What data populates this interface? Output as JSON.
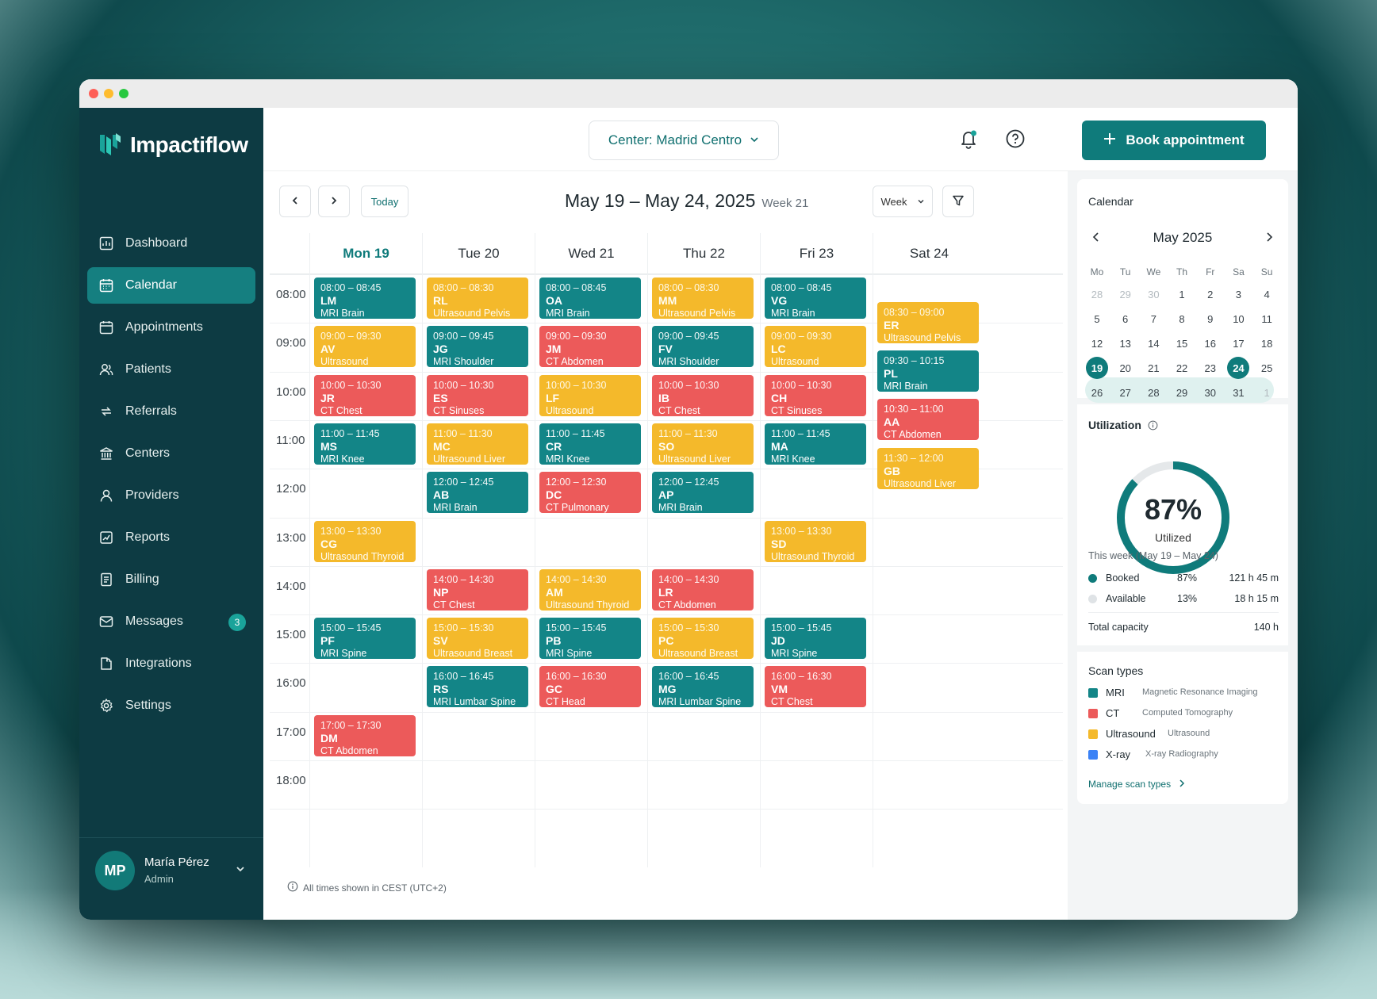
{
  "app": {
    "brand": "Impactiflow"
  },
  "sidebar": {
    "items": [
      {
        "label": "Dashboard",
        "icon": "dashboard-icon"
      },
      {
        "label": "Calendar",
        "icon": "calendar-icon",
        "active": true
      },
      {
        "label": "Appointments",
        "icon": "appointments-icon"
      },
      {
        "label": "Patients",
        "icon": "patients-icon"
      },
      {
        "label": "Referrals",
        "icon": "referrals-icon"
      },
      {
        "label": "Centers",
        "icon": "centers-icon"
      },
      {
        "label": "Providers",
        "icon": "providers-icon"
      },
      {
        "label": "Reports",
        "icon": "reports-icon"
      },
      {
        "label": "Billing",
        "icon": "billing-icon"
      },
      {
        "label": "Messages",
        "icon": "messages-icon",
        "badge": "3"
      },
      {
        "label": "Integrations",
        "icon": "integrations-icon"
      },
      {
        "label": "Settings",
        "icon": "settings-icon"
      }
    ],
    "user": {
      "initials": "MP",
      "name": "María Pérez",
      "role": "Admin"
    }
  },
  "topbar": {
    "center_select": "Center: Madrid Centro",
    "book_label": "Book appointment"
  },
  "toolbar": {
    "today_label": "Today",
    "range": "May 19 – May 24, 2025",
    "week": "Week 21",
    "view": "Week"
  },
  "days": [
    "Mon 19",
    "Tue 20",
    "Wed 21",
    "Thu 22",
    "Fri 23",
    "Sat 24"
  ],
  "hours": [
    "08:00",
    "09:00",
    "10:00",
    "11:00",
    "12:00",
    "13:00",
    "14:00",
    "15:00",
    "16:00",
    "17:00",
    "18:00"
  ],
  "events": [
    {
      "day": 0,
      "time": "08:00 – 08:45",
      "initials": "LM",
      "type": "MRI Brain",
      "kind": "mri"
    },
    {
      "day": 0,
      "time": "09:00 – 09:30",
      "initials": "AV",
      "type": "Ultrasound Abdomen",
      "kind": "us"
    },
    {
      "day": 0,
      "time": "10:00 – 10:30",
      "initials": "JR",
      "type": "CT Chest",
      "kind": "ct"
    },
    {
      "day": 0,
      "time": "11:00 – 11:45",
      "initials": "MS",
      "type": "MRI Knee",
      "kind": "mri"
    },
    {
      "day": 0,
      "time": "13:00 – 13:30",
      "initials": "CG",
      "type": "Ultrasound Thyroid",
      "kind": "us"
    },
    {
      "day": 0,
      "time": "15:00 – 15:45",
      "initials": "PF",
      "type": "MRI Spine",
      "kind": "mri"
    },
    {
      "day": 0,
      "time": "17:00 – 17:30",
      "initials": "DM",
      "type": "CT Abdomen",
      "kind": "ct"
    },
    {
      "day": 1,
      "time": "08:00 – 08:30",
      "initials": "RL",
      "type": "Ultrasound Pelvis",
      "kind": "us"
    },
    {
      "day": 1,
      "time": "09:00 – 09:45",
      "initials": "JG",
      "type": "MRI Shoulder",
      "kind": "mri"
    },
    {
      "day": 1,
      "time": "10:00 – 10:30",
      "initials": "ES",
      "type": "CT Sinuses",
      "kind": "ct"
    },
    {
      "day": 1,
      "time": "11:00 – 11:30",
      "initials": "MC",
      "type": "Ultrasound Liver",
      "kind": "us"
    },
    {
      "day": 1,
      "time": "12:00 – 12:45",
      "initials": "AB",
      "type": "MRI Brain",
      "kind": "mri"
    },
    {
      "day": 1,
      "time": "14:00 – 14:30",
      "initials": "NP",
      "type": "CT Chest",
      "kind": "ct"
    },
    {
      "day": 1,
      "time": "15:00 – 15:30",
      "initials": "SV",
      "type": "Ultrasound Breast",
      "kind": "us"
    },
    {
      "day": 1,
      "time": "16:00 – 16:45",
      "initials": "RS",
      "type": "MRI Lumbar Spine",
      "kind": "mri"
    },
    {
      "day": 2,
      "time": "08:00 – 08:45",
      "initials": "OA",
      "type": "MRI Brain",
      "kind": "mri"
    },
    {
      "day": 2,
      "time": "09:00 – 09:30",
      "initials": "JM",
      "type": "CT Abdomen",
      "kind": "ct"
    },
    {
      "day": 2,
      "time": "10:00 – 10:30",
      "initials": "LF",
      "type": "Ultrasound Abdomen",
      "kind": "us"
    },
    {
      "day": 2,
      "time": "11:00 – 11:45",
      "initials": "CR",
      "type": "MRI Knee",
      "kind": "mri"
    },
    {
      "day": 2,
      "time": "12:00 – 12:30",
      "initials": "DC",
      "type": "CT Pulmonary",
      "kind": "ct"
    },
    {
      "day": 2,
      "time": "14:00 – 14:30",
      "initials": "AM",
      "type": "Ultrasound Thyroid",
      "kind": "us"
    },
    {
      "day": 2,
      "time": "15:00 – 15:45",
      "initials": "PB",
      "type": "MRI Spine",
      "kind": "mri"
    },
    {
      "day": 2,
      "time": "16:00 – 16:30",
      "initials": "GC",
      "type": "CT Head",
      "kind": "ct"
    },
    {
      "day": 3,
      "time": "08:00 – 08:30",
      "initials": "MM",
      "type": "Ultrasound Pelvis",
      "kind": "us"
    },
    {
      "day": 3,
      "time": "09:00 – 09:45",
      "initials": "FV",
      "type": "MRI Shoulder",
      "kind": "mri"
    },
    {
      "day": 3,
      "time": "10:00 – 10:30",
      "initials": "IB",
      "type": "CT Chest",
      "kind": "ct"
    },
    {
      "day": 3,
      "time": "11:00 – 11:30",
      "initials": "SO",
      "type": "Ultrasound Liver",
      "kind": "us"
    },
    {
      "day": 3,
      "time": "12:00 – 12:45",
      "initials": "AP",
      "type": "MRI Brain",
      "kind": "mri"
    },
    {
      "day": 3,
      "time": "14:00 – 14:30",
      "initials": "LR",
      "type": "CT Abdomen",
      "kind": "ct"
    },
    {
      "day": 3,
      "time": "15:00 – 15:30",
      "initials": "PC",
      "type": "Ultrasound Breast",
      "kind": "us"
    },
    {
      "day": 3,
      "time": "16:00 – 16:45",
      "initials": "MG",
      "type": "MRI Lumbar Spine",
      "kind": "mri"
    },
    {
      "day": 4,
      "time": "08:00 – 08:45",
      "initials": "VG",
      "type": "MRI Brain",
      "kind": "mri"
    },
    {
      "day": 4,
      "time": "09:00 – 09:30",
      "initials": "LC",
      "type": "Ultrasound Abdomen",
      "kind": "us"
    },
    {
      "day": 4,
      "time": "10:00 – 10:30",
      "initials": "CH",
      "type": "CT Sinuses",
      "kind": "ct"
    },
    {
      "day": 4,
      "time": "11:00 – 11:45",
      "initials": "MA",
      "type": "MRI Knee",
      "kind": "mri"
    },
    {
      "day": 4,
      "time": "13:00 – 13:30",
      "initials": "SD",
      "type": "Ultrasound Thyroid",
      "kind": "us"
    },
    {
      "day": 4,
      "time": "15:00 – 15:45",
      "initials": "JD",
      "type": "MRI Spine",
      "kind": "mri"
    },
    {
      "day": 4,
      "time": "16:00 – 16:30",
      "initials": "VM",
      "type": "CT Chest",
      "kind": "ct"
    },
    {
      "day": 5,
      "time": "08:30 – 09:00",
      "initials": "ER",
      "type": "Ultrasound Pelvis",
      "kind": "us"
    },
    {
      "day": 5,
      "time": "09:30 – 10:15",
      "initials": "PL",
      "type": "MRI Brain",
      "kind": "mri"
    },
    {
      "day": 5,
      "time": "10:30 – 11:00",
      "initials": "AA",
      "type": "CT Abdomen",
      "kind": "ct"
    },
    {
      "day": 5,
      "time": "11:30 – 12:00",
      "initials": "GB",
      "type": "Ultrasound Liver",
      "kind": "us"
    }
  ],
  "footnote": "All times shown in CEST (UTC+2)",
  "mini_calendar": {
    "title": "Calendar",
    "month": "May 2025",
    "weekdays": [
      "Mo",
      "Tu",
      "We",
      "Th",
      "Fr",
      "Sa",
      "Su"
    ],
    "weeks": [
      [
        "28",
        "29",
        "30",
        "1",
        "2",
        "3",
        "4"
      ],
      [
        "5",
        "6",
        "7",
        "8",
        "9",
        "10",
        "11"
      ],
      [
        "12",
        "13",
        "14",
        "15",
        "16",
        "17",
        "18"
      ],
      [
        "19",
        "20",
        "21",
        "22",
        "23",
        "24",
        "25"
      ],
      [
        "26",
        "27",
        "28",
        "29",
        "30",
        "31",
        "1"
      ]
    ]
  },
  "utilization": {
    "title": "Utilization",
    "percent_label": "87%",
    "percent": 87,
    "sub": "Utilized",
    "period": "This week (May 19 – May 24)",
    "booked": {
      "label": "Booked",
      "pct": "87%",
      "hours": "121 h 45 m"
    },
    "available": {
      "label": "Available",
      "pct": "13%",
      "hours": "18 h 15 m"
    },
    "total": {
      "label": "Total capacity",
      "value": "140 h"
    }
  },
  "scan_types": {
    "title": "Scan types",
    "items": [
      {
        "code": "MRI",
        "desc": "Magnetic Resonance Imaging",
        "color": "#138587"
      },
      {
        "code": "CT",
        "desc": "Computed Tomography",
        "color": "#ec5a5a"
      },
      {
        "code": "Ultrasound",
        "desc": "Ultrasound",
        "color": "#f4b92b"
      },
      {
        "code": "X-ray",
        "desc": "X-ray Radiography",
        "color": "#3b82f6"
      }
    ],
    "manage_label": "Manage scan types"
  },
  "colors": {
    "accent": "#0f7b7b",
    "sidebar": "#0d3b43",
    "mri": "#138587",
    "ct": "#ec5a5a",
    "us": "#f4b92b"
  }
}
